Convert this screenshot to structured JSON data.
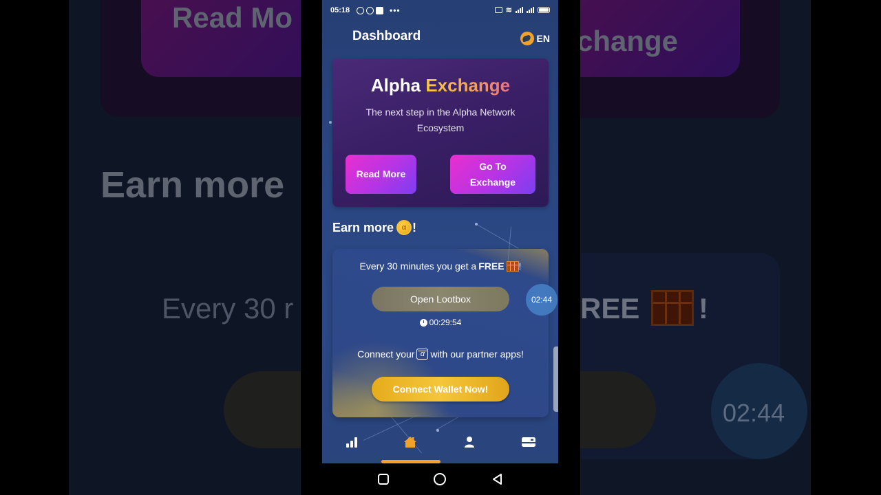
{
  "status_bar": {
    "time": "05:18",
    "left_icons": [
      "record-icon",
      "navigation-icon",
      "app-badge-icon"
    ],
    "overflow": "•••",
    "right_icons": [
      "cast-icon",
      "wifi-icon",
      "signal-icon",
      "signal-icon-2",
      "battery-icon"
    ]
  },
  "header": {
    "title": "Dashboard",
    "language": "EN"
  },
  "exchange_card": {
    "title_main": "Alpha",
    "title_accent": "Exchange",
    "subtitle": "The next step in the Alpha Network Ecosystem",
    "read_more_label": "Read More",
    "go_to_exchange_label": "Go To Exchange"
  },
  "earn": {
    "title": "Earn more",
    "title_suffix": "!",
    "coin_glyph": "α"
  },
  "lootbox": {
    "text_prefix": "Every 30 minutes you get a",
    "text_bold": "FREE",
    "text_suffix": "!",
    "button_label": "Open Lootbox",
    "countdown": "00:29:54",
    "connect_prefix": "Connect your",
    "connect_icon_glyph": "α",
    "connect_suffix": "with our partner apps!",
    "wallet_button_label": "Connect Wallet Now!"
  },
  "floating_timer": "02:44",
  "bottom_nav": {
    "items": [
      {
        "name": "stats",
        "icon": "bar-chart-icon",
        "active": false
      },
      {
        "name": "home",
        "icon": "home-icon",
        "active": true
      },
      {
        "name": "profile",
        "icon": "user-icon",
        "active": false
      },
      {
        "name": "wallet",
        "icon": "card-icon",
        "active": false
      }
    ]
  },
  "background_blur": {
    "read_more": "Read Mo",
    "exchange": "change",
    "earn_more": "Earn more",
    "every_30": "Every 30 r",
    "free": "REE",
    "exclaim": "!",
    "timer": "02:44"
  },
  "colors": {
    "accent_orange": "#f0a22a",
    "button_magenta": "#ea2fce",
    "button_violet": "#7b3ff0",
    "button_gold": "#f4c63a",
    "screen_blue": "#2b4782"
  }
}
